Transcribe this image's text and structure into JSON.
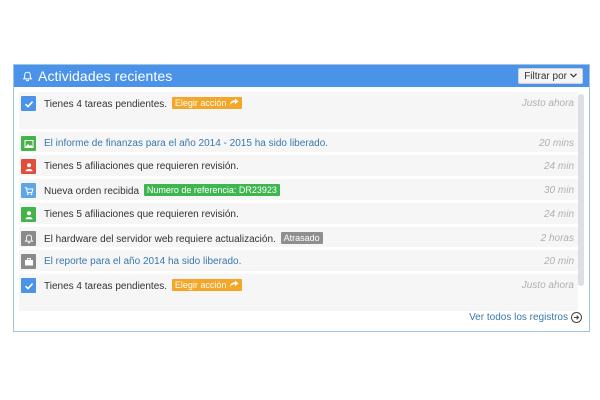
{
  "header": {
    "title": "Actividades recientes",
    "filter_label": "Filtrar por",
    "filter_icon": "chevron-down-icon",
    "bg_color": "#4b93e8"
  },
  "activities": [
    {
      "icon": "check-icon",
      "color": "#4b93e8",
      "text": "Tienes 4 tareas pendientes.",
      "link": false,
      "label": "Elegir acción",
      "label_color": "#f3a627",
      "label_has_arrow": true,
      "time": "Justo ahora"
    },
    {
      "icon": "image-icon",
      "color": "#46b34a",
      "text": "El informe de finanzas para el año 2014 - 2015 ha sido liberado.",
      "link": true,
      "label": "",
      "time": "20 mins"
    },
    {
      "icon": "user-icon",
      "color": "#e14d3b",
      "text": "Tienes 5 afiliaciones que requieren revisión.",
      "link": false,
      "label": "",
      "time": "24 min"
    },
    {
      "icon": "cart-icon",
      "color": "#5ea7e6",
      "text": "Nueva orden recibida",
      "link": false,
      "label": "Numero de referencia: DR23923",
      "label_color": "#3fb550",
      "label_has_arrow": false,
      "time": "30 min"
    },
    {
      "icon": "user-icon",
      "color": "#46b34a",
      "text": "Tienes 5 afiliaciones que requieren revisión.",
      "link": false,
      "label": "",
      "time": "24 min"
    },
    {
      "icon": "bell-icon",
      "color": "#8a8a8a",
      "text": "El hardware del servidor web requiere actualización.",
      "link": false,
      "label": "Atrasado",
      "label_color": "#8f8f8f",
      "label_has_arrow": false,
      "time": "2 horas"
    },
    {
      "icon": "briefcase-icon",
      "color": "#8a8a8a",
      "text": "El reporte para el año 2014 ha sido liberado.",
      "link": true,
      "label": "",
      "time": "20 min"
    },
    {
      "icon": "check-icon",
      "color": "#4b93e8",
      "text": "Tienes 4 tareas pendientes.",
      "link": false,
      "label": "Elegir acción",
      "label_color": "#f3a627",
      "label_has_arrow": true,
      "time": "Justo ahora"
    }
  ],
  "footer": {
    "view_all": "Ver todos los registros",
    "icon": "arrow-circle-right-icon"
  }
}
